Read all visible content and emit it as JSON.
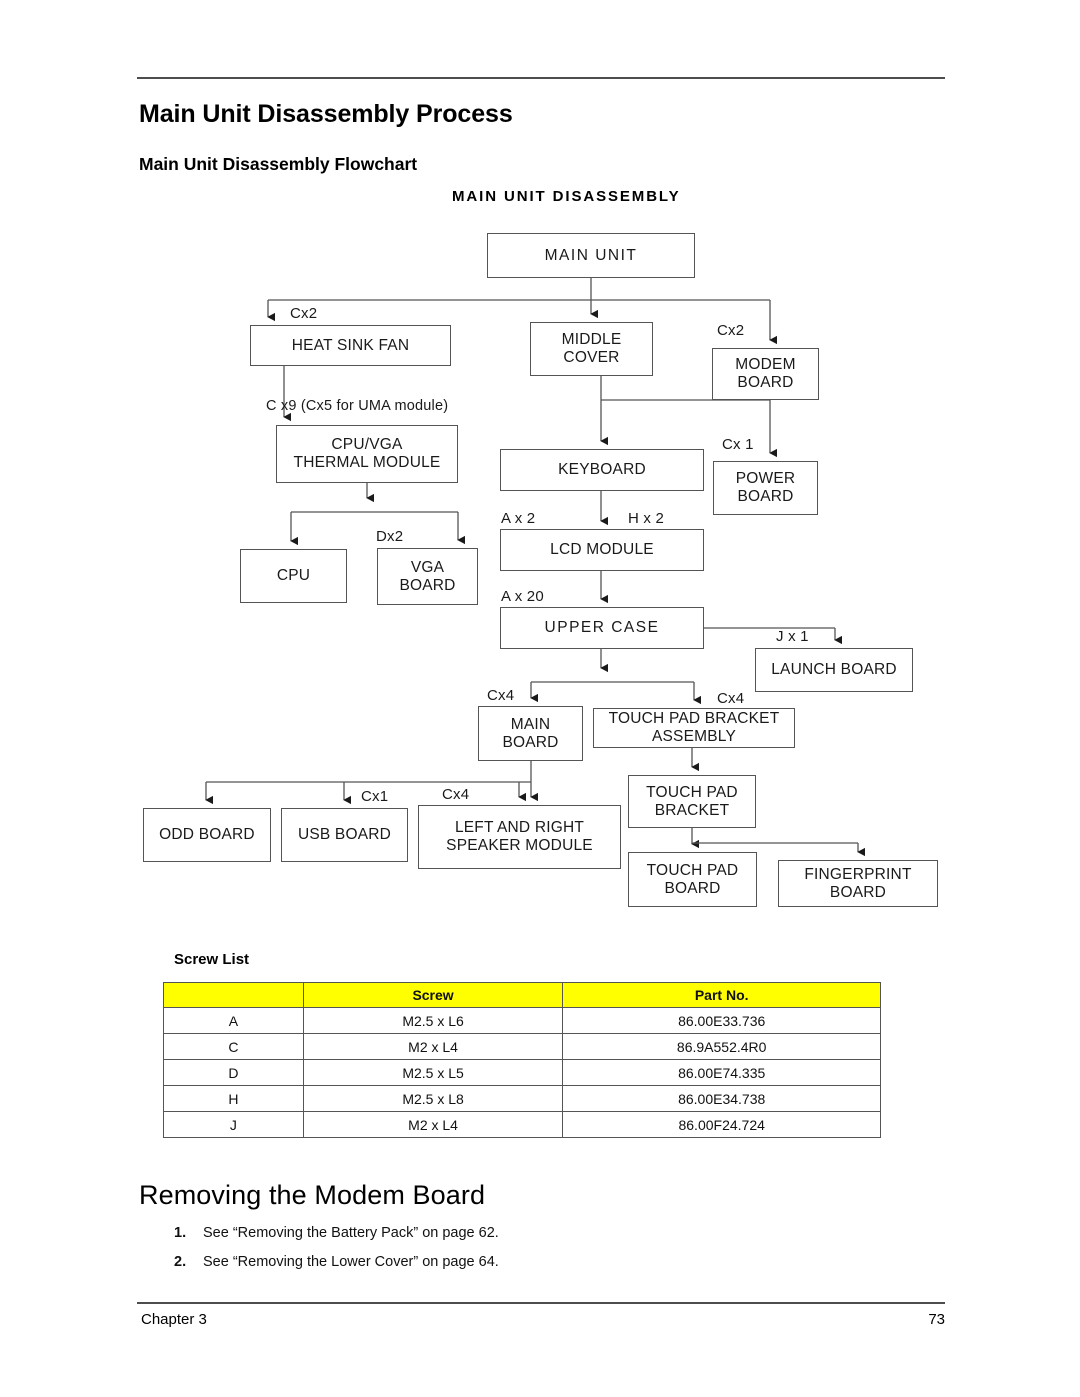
{
  "document": {
    "heading_main": "Main Unit Disassembly Process",
    "heading_sub": "Main Unit Disassembly Flowchart",
    "chart_title": "MAIN UNIT DISASSEMBLY",
    "heading_removing": "Removing the Modem Board",
    "footer_chapter": "Chapter 3",
    "footer_page": "73"
  },
  "flowchart": {
    "nodes": {
      "main_unit": "MAIN  UNIT",
      "heat_sink_fan": "HEAT SINK FAN",
      "middle_cover": "MIDDLE\nCOVER",
      "modem_board": "MODEM\nBOARD",
      "cpu_vga_thermal": "CPU/VGA\nTHERMAL MODULE",
      "keyboard": "KEYBOARD",
      "power_board": "POWER\nBOARD",
      "cpu": "CPU",
      "vga_board": "VGA\nBOARD",
      "lcd_module": "LCD MODULE",
      "upper_case": "UPPER  CASE",
      "launch_board": "LAUNCH BOARD",
      "main_board": "MAIN\nBOARD",
      "touch_pad_bracket_assembly": "TOUCH PAD BRACKET\nASSEMBLY",
      "odd_board": "ODD BOARD",
      "usb_board": "USB BOARD",
      "left_right_speaker": "LEFT AND RIGHT\nSPEAKER MODULE",
      "touch_pad_bracket": "TOUCH PAD\nBRACKET",
      "touch_pad_board": "TOUCH PAD\nBOARD",
      "fingerprint_board": "FINGERPRINT\nBOARD"
    },
    "labels": {
      "heat_sink_fan": "Cx2",
      "modem_board": "Cx2",
      "cpu_vga_thermal": "C x9 (Cx5 for UMA module)",
      "power_board": "Cx 1",
      "vga_board": "Dx2",
      "lcd_left": "A x 2",
      "lcd_right": "H x 2",
      "upper_case": "A x 20",
      "launch_board": "J x 1",
      "main_board": "Cx4",
      "touch_pad_bracket_assembly": "Cx4",
      "usb_board": "Cx1",
      "left_right_speaker": "Cx4"
    }
  },
  "screw_list": {
    "title": "Screw List",
    "headers": [
      "",
      "Screw",
      "Part No."
    ],
    "rows": [
      [
        "A",
        "M2.5 x L6",
        "86.00E33.736"
      ],
      [
        "C",
        "M2 x L4",
        "86.9A552.4R0"
      ],
      [
        "D",
        "M2.5 x L5",
        "86.00E74.335"
      ],
      [
        "H",
        "M2.5 x L8",
        "86.00E34.738"
      ],
      [
        "J",
        "M2 x L4",
        "86.00F24.724"
      ]
    ]
  },
  "steps": [
    {
      "num": "1.",
      "text": "See “Removing the Battery Pack” on page 62."
    },
    {
      "num": "2.",
      "text": "See “Removing the Lower Cover” on page 64."
    }
  ],
  "colors": {
    "header_highlight": "#ffff00",
    "line": "#555555",
    "rule": "#4d4d4d"
  }
}
